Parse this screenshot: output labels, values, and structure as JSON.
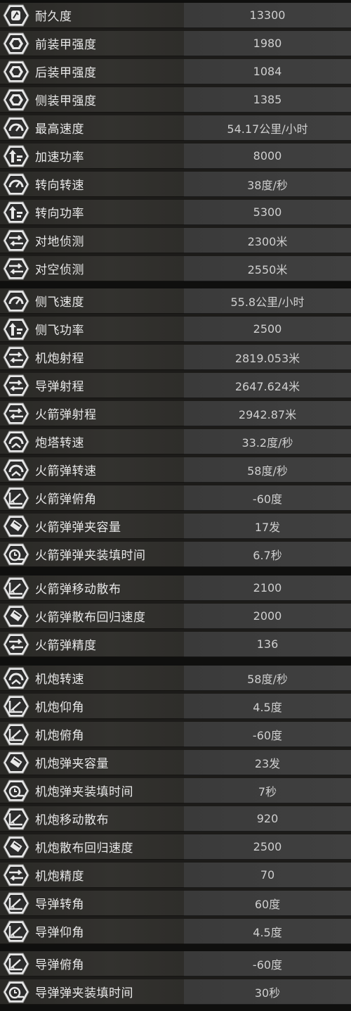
{
  "stats": [
    {
      "icon": "durability-icon",
      "label": "耐久度",
      "value": "13300"
    },
    {
      "icon": "armor-icon",
      "label": "前装甲强度",
      "value": "1980"
    },
    {
      "icon": "armor-icon",
      "label": "后装甲强度",
      "value": "1084"
    },
    {
      "icon": "armor-icon",
      "label": "侧装甲强度",
      "value": "1385"
    },
    {
      "icon": "speedometer-icon",
      "label": "最高速度",
      "value": "54.17公里/小时"
    },
    {
      "icon": "power-icon",
      "label": "加速功率",
      "value": "8000"
    },
    {
      "icon": "speedometer-icon",
      "label": "转向转速",
      "value": "38度/秒"
    },
    {
      "icon": "power-icon",
      "label": "转向功率",
      "value": "5300"
    },
    {
      "icon": "range-icon",
      "label": "对地侦测",
      "value": "2300米"
    },
    {
      "icon": "range-icon",
      "label": "对空侦测",
      "value": "2550米"
    },
    {
      "icon": "speedometer-icon",
      "label": "侧飞速度",
      "value": "55.8公里/小时"
    },
    {
      "icon": "power-icon",
      "label": "侧飞功率",
      "value": "2500"
    },
    {
      "icon": "range-icon",
      "label": "机炮射程",
      "value": "2819.053米"
    },
    {
      "icon": "range-icon",
      "label": "导弹射程",
      "value": "2647.624米"
    },
    {
      "icon": "range-icon",
      "label": "火箭弹射程",
      "value": "2942.87米"
    },
    {
      "icon": "turret-speed-icon",
      "label": "炮塔转速",
      "value": "33.2度/秒"
    },
    {
      "icon": "turret-speed-icon",
      "label": "火箭弹转速",
      "value": "58度/秒"
    },
    {
      "icon": "angle-icon",
      "label": "火箭弹俯角",
      "value": "-60度"
    },
    {
      "icon": "magazine-icon",
      "label": "火箭弹弹夹容量",
      "value": "17发"
    },
    {
      "icon": "reload-icon",
      "label": "火箭弹弹夹装填时间",
      "value": "6.7秒"
    },
    {
      "icon": "angle-icon",
      "label": "火箭弹移动散布",
      "value": "2100"
    },
    {
      "icon": "magazine-icon",
      "label": "火箭弹散布回归速度",
      "value": "2000"
    },
    {
      "icon": "range-icon",
      "label": "火箭弹精度",
      "value": "136"
    },
    {
      "icon": "turret-speed-icon",
      "label": "机炮转速",
      "value": "58度/秒"
    },
    {
      "icon": "angle-icon",
      "label": "机炮仰角",
      "value": "4.5度"
    },
    {
      "icon": "angle-icon",
      "label": "机炮俯角",
      "value": "-60度"
    },
    {
      "icon": "magazine-icon",
      "label": "机炮弹夹容量",
      "value": "23发"
    },
    {
      "icon": "reload-icon",
      "label": "机炮弹夹装填时间",
      "value": "7秒"
    },
    {
      "icon": "angle-icon",
      "label": "机炮移动散布",
      "value": "920"
    },
    {
      "icon": "magazine-icon",
      "label": "机炮散布回归速度",
      "value": "2500"
    },
    {
      "icon": "range-icon",
      "label": "机炮精度",
      "value": "70"
    },
    {
      "icon": "angle-icon",
      "label": "导弹转角",
      "value": "60度"
    },
    {
      "icon": "angle-icon",
      "label": "导弹仰角",
      "value": "4.5度"
    },
    {
      "icon": "angle-icon",
      "label": "导弹俯角",
      "value": "-60度"
    },
    {
      "icon": "reload-icon",
      "label": "导弹弹夹装填时间",
      "value": "30秒"
    }
  ]
}
